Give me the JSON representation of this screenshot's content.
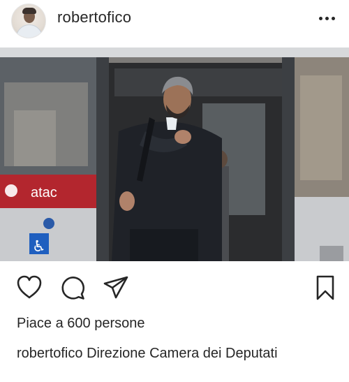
{
  "post": {
    "username": "robertofico",
    "likes_text": "Piace a 600 persone",
    "caption_user": "robertofico",
    "caption_text": "Direzione Camera dei Deputati"
  },
  "photo": {
    "bus_logo_text": "atac",
    "accessibility_symbol": "♿"
  },
  "icons": {
    "more": "more-options-icon",
    "like": "heart-icon",
    "comment": "comment-icon",
    "share": "direct-share-icon",
    "save": "bookmark-icon"
  },
  "colors": {
    "text": "#262626",
    "bus_red": "#b3262e",
    "bus_silver": "#c9cbce"
  }
}
